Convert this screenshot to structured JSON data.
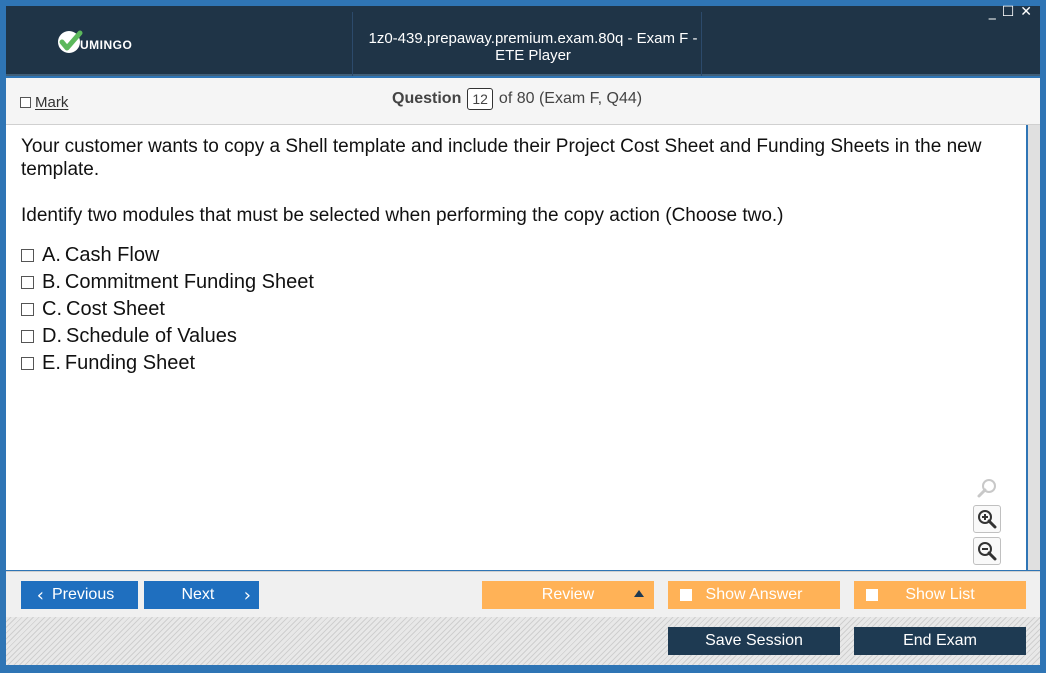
{
  "app": {
    "logo_text": "UMINGO",
    "window_title": "1z0-439.prepaway.premium.exam.80q - Exam F - ETE Player",
    "controls": {
      "minimize": "_",
      "maximize": "☐",
      "close": "✕"
    }
  },
  "question_bar": {
    "mark_label": "Mark",
    "question_label": "Question",
    "question_number": "12",
    "of_text": "of 80 (Exam F, Q44)"
  },
  "question": {
    "text": "Your customer wants to copy a Shell template and include their Project Cost Sheet and Funding Sheets in the new template.",
    "instruction": "Identify two modules that must be selected when performing the copy action (Choose two.)",
    "options": [
      {
        "letter": "A.",
        "text": "Cash Flow"
      },
      {
        "letter": "B.",
        "text": "Commitment Funding Sheet"
      },
      {
        "letter": "C.",
        "text": "Cost Sheet"
      },
      {
        "letter": "D.",
        "text": "Schedule of Values"
      },
      {
        "letter": "E.",
        "text": "Funding Sheet"
      }
    ]
  },
  "nav": {
    "previous": "Previous",
    "next": "Next",
    "review": "Review",
    "show_answer": "Show Answer",
    "show_list": "Show List",
    "save_session": "Save Session",
    "end_exam": "End Exam"
  },
  "colors": {
    "titlebar": "#1f3447",
    "accent_blue": "#1f6fbf",
    "orange": "#ffb257",
    "dark_button": "#1e3a52",
    "logo_green": "#5cb85c"
  },
  "icons": [
    "check-logo-icon",
    "search-icon",
    "zoom-in-icon",
    "zoom-out-icon",
    "chevron-left-icon",
    "chevron-right-icon",
    "triangle-up-icon"
  ]
}
